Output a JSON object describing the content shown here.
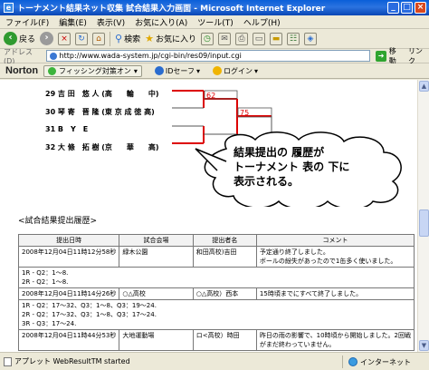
{
  "window": {
    "title": "トーナメント結果ネット収集 試合結果入力画面 - Microsoft Internet Explorer",
    "buttons": {
      "minimize": "_",
      "maximize": "□",
      "close": "×"
    }
  },
  "menu": [
    "ファイル(F)",
    "編集(E)",
    "表示(V)",
    "お気に入り(A)",
    "ツール(T)",
    "ヘルプ(H)"
  ],
  "toolbar": {
    "back": "戻る",
    "search": "検索",
    "favorites": "お気に入り"
  },
  "address": {
    "label": "アドレス(D)",
    "url": "http://www.wada-system.jp/cgi-bin/res09/input.cgi",
    "go": "移動",
    "links": "リンク"
  },
  "norton": {
    "logo": "Norton",
    "phishing": "フィッシング対策オン",
    "id_safe": "IDセーフ",
    "login": "ログイン"
  },
  "bracket": {
    "players": [
      "29 吉 田　悠 人 (高　　輪　　中)",
      "30 琴 寄　晋 隆 (東 京 成 徳 高)",
      "31 B　Y　E",
      "32 大 條　拓 樹 (京　　華　　高)"
    ],
    "scores": [
      "62",
      "75"
    ]
  },
  "callout": {
    "lines": [
      "結果提出の 履歴が",
      "トーナメント 表の 下に",
      "表示される。"
    ]
  },
  "history": {
    "title": "<試合結果提出履歴>",
    "headers": [
      "提出日時",
      "試合会場",
      "提出者名",
      "コメント"
    ],
    "rows": [
      {
        "datetime": "2008年12月04日11時12分58秒",
        "venue": "緑木公園",
        "submitter": "和田高校)吉田",
        "comment": [
          "予定通り終了しました。",
          "ボールの紛失があったので1缶多く使いました。"
        ],
        "details": [
          "1R - Q2：1～8.",
          "2R - Q2：1～8."
        ]
      },
      {
        "datetime": "2008年12月04日11時14分26秒",
        "venue": "○△高校",
        "submitter": "○△高校）西本",
        "comment": [
          "15時頃までにすべて終了しました。"
        ],
        "details": [
          "1R - Q2：17～32、Q3：1～8、Q3：19～24.",
          "2R - Q2：17～32、Q3：1～8、Q3：17～24.",
          "3R - Q3：17～24."
        ]
      },
      {
        "datetime": "2008年12月04日11時44分53秒",
        "venue": "大地運動場",
        "submitter": "ロ<高校）時田",
        "comment": [
          "昨日の雨の影響で、10時頃から開始しました。2回戦",
          "がまだ終わっていません。"
        ],
        "details": []
      }
    ]
  },
  "status": {
    "text": "アプレット WebResultTM started",
    "zone": "インターネット"
  }
}
